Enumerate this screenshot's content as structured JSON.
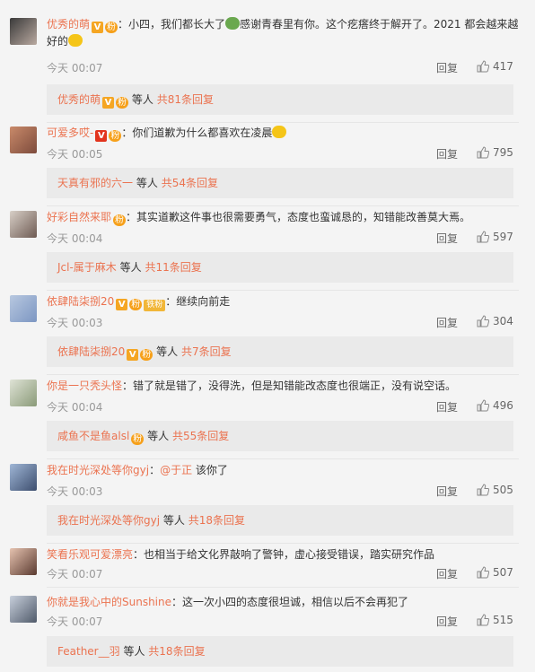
{
  "comments": [
    {
      "user": "优秀的萌",
      "text": "：小四，我们都长大了",
      "text2": "感谢青春里有你。这个疙瘩终于解开了。2021 都会越来越好的",
      "time": "今天 00:07",
      "reply_label": "回复",
      "likes": "417",
      "sub_user": "优秀的萌",
      "sub_mid": "等人",
      "sub_count": "共81条回复"
    },
    {
      "user": "可爱多哎-",
      "text": "：你们道歉为什么都喜欢在凌晨",
      "time": "今天 00:05",
      "reply_label": "回复",
      "likes": "795",
      "sub_user": "天真有邪的六一",
      "sub_mid": "等人",
      "sub_count": "共54条回复"
    },
    {
      "user": "好彩自然来耶",
      "text": "：其实道歉这件事也很需要勇气，态度也蛮诚恳的，知错能改善莫大焉。",
      "time": "今天 00:04",
      "reply_label": "回复",
      "likes": "597",
      "sub_user": "Jcl-属于麻木",
      "sub_mid": "等人",
      "sub_count": "共11条回复"
    },
    {
      "user": "依肆陆柒捌20",
      "fan_badge": "铁粉",
      "text": "：继续向前走",
      "time": "今天 00:03",
      "reply_label": "回复",
      "likes": "304",
      "sub_user": "依肆陆柒捌20",
      "sub_mid": "等人",
      "sub_count": "共7条回复"
    },
    {
      "user": "你是一只秃头怪",
      "text": "：错了就是错了，没得洗，但是知错能改态度也很端正，没有说空话。",
      "time": "今天 00:04",
      "reply_label": "回复",
      "likes": "496",
      "sub_user": "咸鱼不是鱼alsl",
      "sub_mid": "等人",
      "sub_count": "共55条回复"
    },
    {
      "user": "我在时光深处等你gyj",
      "text": "：",
      "mention": "@于正",
      "text_after": " 该你了",
      "time": "今天 00:03",
      "reply_label": "回复",
      "likes": "505",
      "sub_user": "我在时光深处等你gyj",
      "sub_mid": "等人",
      "sub_count": "共18条回复"
    },
    {
      "user": "笑看乐观可爱漂亮",
      "text": "：也相当于给文化界敲响了警钟，虚心接受错误，踏实研究作品",
      "time": "今天 00:07",
      "reply_label": "回复",
      "likes": "507"
    },
    {
      "user": "你就是我心中的Sunshine",
      "text": "：这一次小四的态度很坦诚，相信以后不会再犯了",
      "time": "今天 00:07",
      "reply_label": "回复",
      "likes": "515",
      "sub_user": "Feather__羽",
      "sub_mid": "等人",
      "sub_count": "共18条回复"
    }
  ],
  "badges": {
    "v": "V",
    "medal": "粉"
  },
  "colors": {
    "username": "#eb7350",
    "background": "#f4f4f4",
    "subbox": "#eaeaea",
    "v_badge": "#f5a623"
  },
  "icons": {
    "like": "thumbs-up-icon"
  }
}
